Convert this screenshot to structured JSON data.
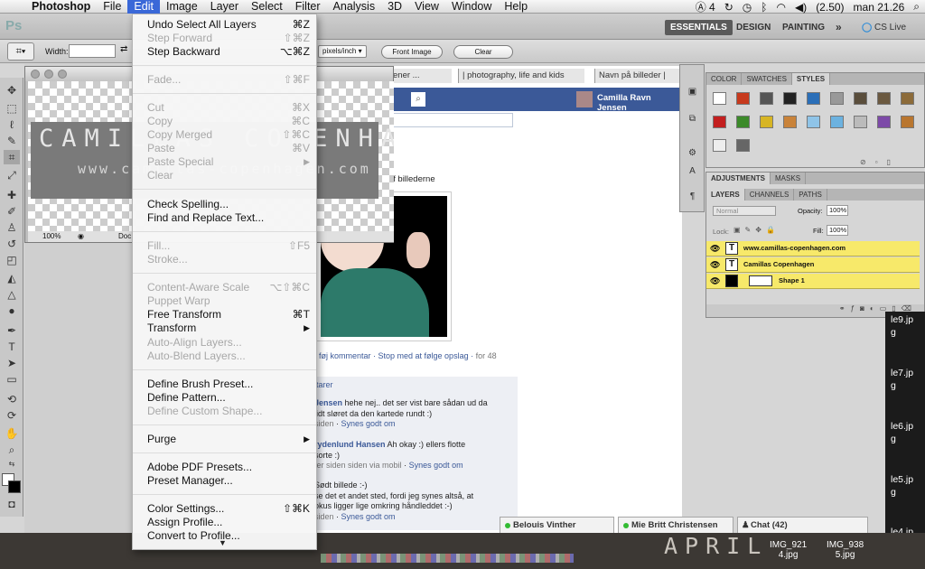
{
  "menubar": {
    "app": "Photoshop",
    "items": [
      "File",
      "Edit",
      "Image",
      "Layer",
      "Select",
      "Filter",
      "Analysis",
      "3D",
      "View",
      "Window",
      "Help"
    ],
    "active": "Edit",
    "status": {
      "adobe": "4",
      "battery": "(2.50)",
      "clock": "man 21.26"
    }
  },
  "appbar": {
    "logo": "Ps",
    "workspaces": [
      "ESSENTIALS",
      "DESIGN",
      "PAINTING"
    ],
    "more": "»",
    "cslive": "CS Live"
  },
  "options": {
    "width_label": "Width:",
    "width_value": "",
    "units": "pixels/inch",
    "front_image": "Front Image",
    "clear": "Clear"
  },
  "edit_menu": {
    "items": [
      {
        "label": "Undo Select All Layers",
        "shortcut": "⌘Z",
        "enabled": true
      },
      {
        "label": "Step Forward",
        "shortcut": "⇧⌘Z",
        "enabled": false
      },
      {
        "label": "Step Backward",
        "shortcut": "⌥⌘Z",
        "enabled": true
      },
      {
        "label": "Fade...",
        "shortcut": "⇧⌘F",
        "enabled": false
      },
      {
        "label": "Cut",
        "shortcut": "⌘X",
        "enabled": false
      },
      {
        "label": "Copy",
        "shortcut": "⌘C",
        "enabled": false
      },
      {
        "label": "Copy Merged",
        "shortcut": "⇧⌘C",
        "enabled": false
      },
      {
        "label": "Paste",
        "shortcut": "⌘V",
        "enabled": false
      },
      {
        "label": "Paste Special",
        "shortcut": "▶",
        "enabled": false
      },
      {
        "label": "Clear",
        "shortcut": "",
        "enabled": false
      },
      {
        "label": "Check Spelling...",
        "shortcut": "",
        "enabled": true
      },
      {
        "label": "Find and Replace Text...",
        "shortcut": "",
        "enabled": true
      },
      {
        "label": "Fill...",
        "shortcut": "⇧F5",
        "enabled": false
      },
      {
        "label": "Stroke...",
        "shortcut": "",
        "enabled": false
      },
      {
        "label": "Content-Aware Scale",
        "shortcut": "⌥⇧⌘C",
        "enabled": false
      },
      {
        "label": "Puppet Warp",
        "shortcut": "",
        "enabled": false
      },
      {
        "label": "Free Transform",
        "shortcut": "⌘T",
        "enabled": true
      },
      {
        "label": "Transform",
        "shortcut": "▶",
        "enabled": true
      },
      {
        "label": "Auto-Align Layers...",
        "shortcut": "",
        "enabled": false
      },
      {
        "label": "Auto-Blend Layers...",
        "shortcut": "",
        "enabled": false
      },
      {
        "label": "Define Brush Preset...",
        "shortcut": "",
        "enabled": true
      },
      {
        "label": "Define Pattern...",
        "shortcut": "",
        "enabled": true
      },
      {
        "label": "Define Custom Shape...",
        "shortcut": "",
        "enabled": false
      },
      {
        "label": "Purge",
        "shortcut": "▶",
        "enabled": true
      },
      {
        "label": "Adobe PDF Presets...",
        "shortcut": "",
        "enabled": true
      },
      {
        "label": "Preset Manager...",
        "shortcut": "",
        "enabled": true
      },
      {
        "label": "Color Settings...",
        "shortcut": "⇧⌘K",
        "enabled": true
      },
      {
        "label": "Assign Profile...",
        "shortcut": "",
        "enabled": true
      },
      {
        "label": "Convert to Profile...",
        "shortcut": "",
        "enabled": true
      }
    ],
    "scroll_indicator": "▼"
  },
  "document": {
    "watermark_title": "CAMILLAS COPENHAGEN",
    "watermark_url": "www.camillas-copenhagen.com",
    "zoom": "100%",
    "status_label": "Doc:"
  },
  "browser": {
    "tabs": [
      "ener ...",
      "| photography, life and kids",
      "Navn på billeder |"
    ],
    "user": "Camilla Ravn Jensen",
    "post_text": "r var en af billederne",
    "actions": {
      "comment": "føj kommentar",
      "stop": "Stop med at følge opslag",
      "count": "for 48"
    },
    "comments_header": "tarer",
    "comments": [
      {
        "name": "Jensen",
        "text": "hehe nej.. det ser vist bare sådan ud da",
        "text2": "lidt sløret da den kartede rundt :)",
        "meta": "siden",
        "like": "Synes godt om"
      },
      {
        "name": "rydenlund Hansen",
        "text": "Ah okay :) ellers flotte",
        "text2": "sorte :)",
        "meta": "ter siden siden via mobil",
        "like": "Synes godt om"
      },
      {
        "name": "",
        "text": "Sødt billede :-)",
        "text2": "se det et andet sted, fordi jeg synes altså, at",
        "text3": "okus ligger lige omkring håndleddet :-)",
        "meta": "siden",
        "like": "Synes godt om"
      }
    ],
    "chats": [
      "Belouis Vinther",
      "Mie Britt Christensen",
      "Chat (42)"
    ]
  },
  "panels": {
    "swatch_tabs": [
      "COLOR",
      "SWATCHES",
      "STYLES"
    ],
    "adjust_tabs": [
      "ADJUSTMENTS",
      "MASKS"
    ],
    "layer_tabs": [
      "LAYERS",
      "CHANNELS",
      "PATHS"
    ],
    "blend_mode": "Normal",
    "opacity_label": "Opacity:",
    "opacity": "100%",
    "lock_label": "Lock:",
    "fill_label": "Fill:",
    "fill": "100%",
    "layers": [
      {
        "name": "www.camillas-copenhagen.com",
        "type": "T"
      },
      {
        "name": "Camillas Copenhagen",
        "type": "T"
      },
      {
        "name": "Shape 1",
        "type": "shape"
      }
    ]
  },
  "desktop": {
    "files": [
      "le9.jp",
      "g",
      "le7.jp",
      "g",
      "le6.jp",
      "g",
      "le5.jp",
      "g",
      "le4.jp",
      "g"
    ],
    "thumbs": [
      "IMG_921",
      "4.jpg",
      "IMG_938",
      "5.jpg"
    ],
    "april": "APRIL"
  }
}
